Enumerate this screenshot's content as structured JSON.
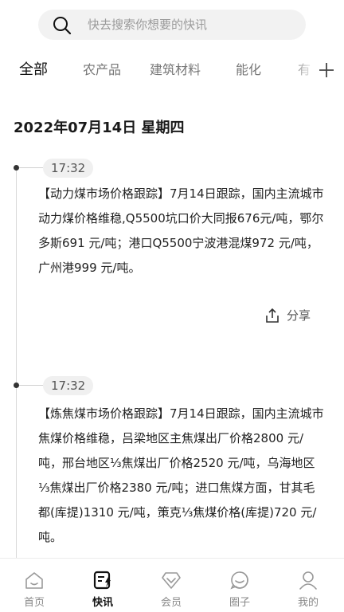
{
  "search": {
    "placeholder": "快去搜索你想要的快讯",
    "icon": "search-icon"
  },
  "tabs": [
    {
      "label": "全部",
      "active": true
    },
    {
      "label": "农产品",
      "active": false
    },
    {
      "label": "建筑材料",
      "active": false
    },
    {
      "label": "能化",
      "active": false
    },
    {
      "label": "有",
      "active": false
    }
  ],
  "feed": {
    "date": "2022年07月14日 星期四",
    "items": [
      {
        "time": "17:32",
        "text": "【动力煤市场价格跟踪】7月14日跟踪，国内主流城市动力煤价格维稳,Q5500坑口价大同报676元/吨，鄂尔多斯691 元/吨；港口Q5500宁波港混煤972 元/吨，广州港999 元/吨。",
        "share_label": "分享"
      },
      {
        "time": "17:32",
        "text": "【炼焦煤市场价格跟踪】7月14日跟踪，国内主流城市焦煤价格维稳，吕梁地区主焦煤出厂价格2800 元/吨，邢台地区⅓焦煤出厂价格2520 元/吨，乌海地区⅓焦煤出厂价格2380 元/吨；进口焦煤方面，甘其毛都(库提)1310 元/吨，策克⅓焦煤价格(库提)720 元/吨。"
      }
    ]
  },
  "nav": [
    {
      "label": "首页",
      "icon": "home-icon",
      "active": false
    },
    {
      "label": "快讯",
      "icon": "flash-news-icon",
      "active": true
    },
    {
      "label": "会员",
      "icon": "member-icon",
      "active": false
    },
    {
      "label": "圈子",
      "icon": "circle-icon",
      "active": false
    },
    {
      "label": "我的",
      "icon": "profile-icon",
      "active": false
    }
  ],
  "colors": {
    "active_text": "#111111",
    "inactive_text": "#888888",
    "background": "#f5f5f5"
  }
}
